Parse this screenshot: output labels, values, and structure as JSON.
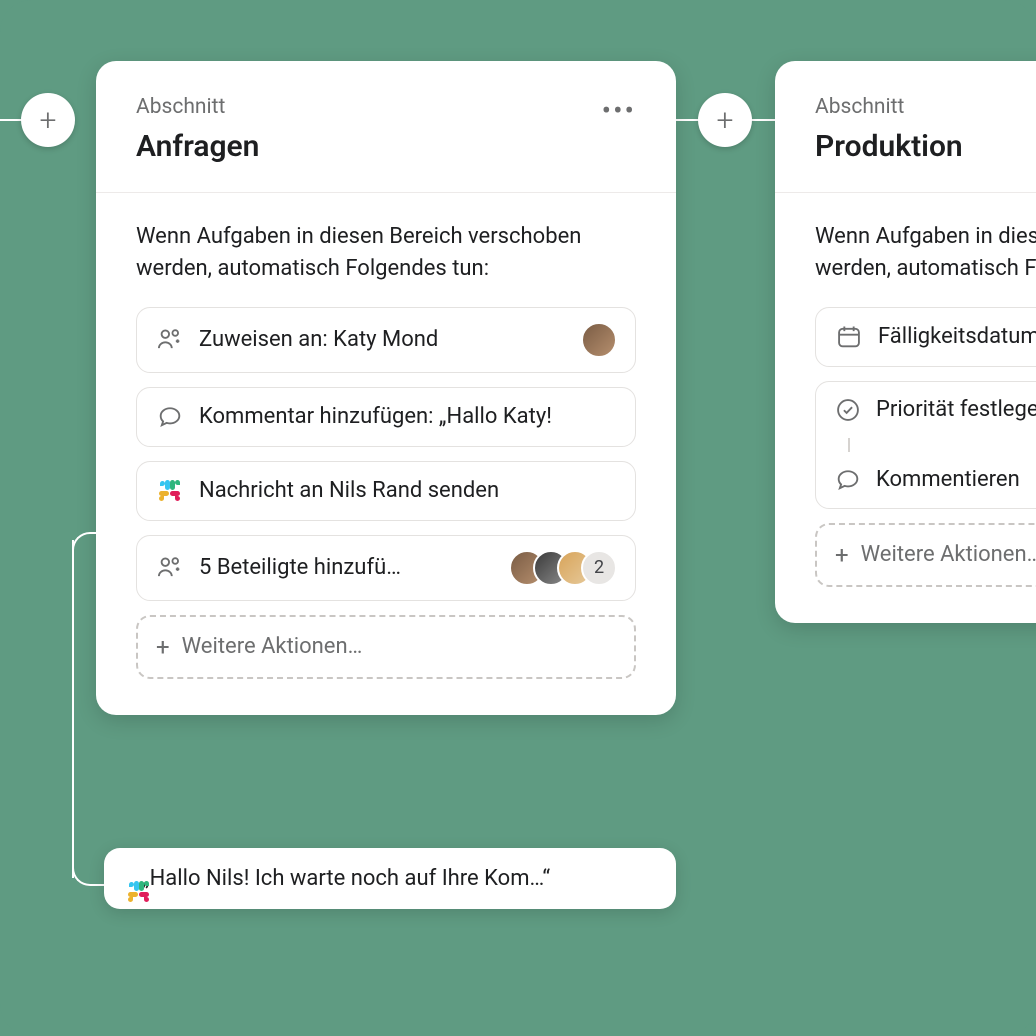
{
  "columns": [
    {
      "label": "Abschnitt",
      "title": "Anfragen",
      "intro": "Wenn Aufgaben in diesen Bereich verschoben werden, automatisch Folgendes tun:",
      "actions": {
        "assign": "Zuweisen an: Katy Mond",
        "comment": "Kommentar hinzufügen: „Hallo Katy!",
        "slack": "Nachricht an Nils Rand senden",
        "collab": "5 Beteiligte hinzufü…",
        "collab_overflow": "2"
      },
      "add_more": "Weitere Aktionen…"
    },
    {
      "label": "Abschnitt",
      "title": "Produktion",
      "intro": "Wenn Aufgaben in diesen Bereich verschoben werden, automatisch Folgendes tun:",
      "actions": {
        "due": "Fälligkeitsdatum festlegen",
        "priority": "Priorität festlegen",
        "comment": "Kommentieren"
      },
      "add_more": "Weitere Aktionen…"
    }
  ],
  "preview_message": "„Hallo Nils! Ich warte noch auf Ihre Kom…“"
}
